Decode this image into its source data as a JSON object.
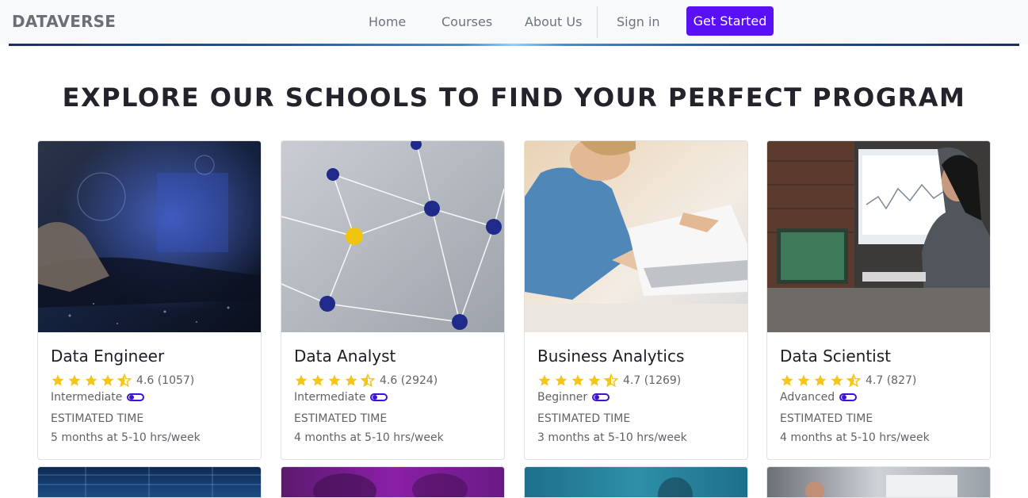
{
  "navbar": {
    "brand": "DATAVERSE",
    "links": [
      "Home",
      "Courses",
      "About Us",
      "Sign in"
    ],
    "cta": "Get Started"
  },
  "section": {
    "title": "EXPLORE OUR SCHOOLS TO FIND YOUR PERFECT PROGRAM"
  },
  "cards": [
    {
      "title": "Data Engineer",
      "rating": "4.6 (1057)",
      "stars": 4.5,
      "level": "Intermediate",
      "est_label": "ESTIMATED TIME",
      "est_value": "5 months at 5-10 hrs/week"
    },
    {
      "title": "Data Analyst",
      "rating": "4.6 (2924)",
      "stars": 4.5,
      "level": "Intermediate",
      "est_label": "ESTIMATED TIME",
      "est_value": "4 months at 5-10 hrs/week"
    },
    {
      "title": "Business Analytics",
      "rating": "4.7 (1269)",
      "stars": 4.5,
      "level": "Beginner",
      "est_label": "ESTIMATED TIME",
      "est_value": "3 months at 5-10 hrs/week"
    },
    {
      "title": "Data Scientist",
      "rating": "4.7 (827)",
      "stars": 4.5,
      "level": "Advanced",
      "est_label": "ESTIMATED TIME",
      "est_value": "4 months at 5-10 hrs/week"
    }
  ],
  "colors": {
    "primary": "#5a10f5",
    "star": "#f5c518",
    "level_icon": "#3d14d6"
  },
  "icons": {
    "rating": "star-icon",
    "level": "difficulty-toggle-icon"
  }
}
